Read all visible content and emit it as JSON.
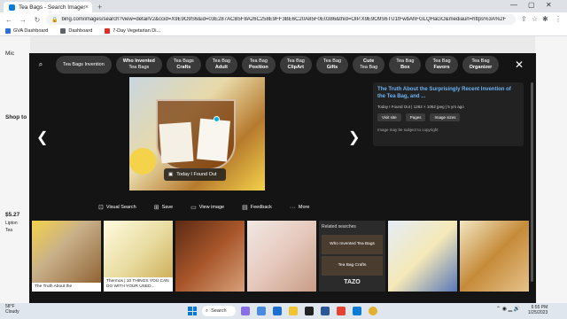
{
  "browser": {
    "tab_title": "Tea Bags - Search Images",
    "tab_close": "×",
    "new_tab": "+",
    "url": "bing.com/images/search?view=detailV2&ccid=X9E9O9S6&id=03E287ACB5F8A26C258E9FF3BE6C20A85F0E0386&thid=OIP.X9E9O9S6TU1tFwbAhFGLQHaGO&mediaurl=https%3A%2F",
    "bookmarks": [
      {
        "label": "GVA Dashboard",
        "color": "#2f6fd6"
      },
      {
        "label": "Dashboard",
        "color": "#5f6368"
      },
      {
        "label": "7-Day Vegetarian Di...",
        "color": "#d93025"
      }
    ]
  },
  "background_page": {
    "side_labels": [
      "Mic",
      "Shop to",
      "$5.27",
      "Lipton",
      "Tea"
    ]
  },
  "overlay": {
    "chips": [
      {
        "line1": "Tea Bags Invention",
        "line2": ""
      },
      {
        "line1": "Who Invented",
        "line2": "Tea Bags"
      },
      {
        "line1": "Tea Bags",
        "line2": "Crafts"
      },
      {
        "line1": "Tea Bag",
        "line2": "Adult"
      },
      {
        "line1": "Tea Bag",
        "line2": "Position"
      },
      {
        "line1": "Tea Bag",
        "line2": "ClipArt"
      },
      {
        "line1": "Tea Bag",
        "line2": "Gifts"
      },
      {
        "line1": "Cute",
        "line2": "Tea Bag"
      },
      {
        "line1": "Tea Bag",
        "line2": "Box"
      },
      {
        "line1": "Tea Bag",
        "line2": "Favors"
      },
      {
        "line1": "Tea Bag",
        "line2": "Organizer"
      }
    ],
    "source_badge": "Today I Found Out",
    "info": {
      "title": "The Truth About the Surprisingly Recent Invention of the Tea Bag, and ...",
      "meta": "Today I Found Out  |  1262 × 1062 jpeg  |  5 yrs ago",
      "buttons": [
        "Visit site",
        "Pages",
        "Image sizes"
      ],
      "note": "Image may be subject to copyright"
    },
    "actions": [
      "Visual Search",
      "Save",
      "View image",
      "Feedback",
      "More"
    ],
    "thumbs": [
      {
        "caption": "The Truth About the"
      },
      {
        "caption": "Thermos | 10 THINGS YOU CAN DO WITH YOUR USED..."
      },
      {
        "caption": ""
      },
      {
        "caption": ""
      }
    ],
    "related": {
      "heading": "Related searches",
      "items": [
        "Who Invented Tea Bags",
        "Tea Bag Crafts"
      ]
    },
    "bottom_text": "TAZO"
  },
  "taskbar": {
    "weather_temp": "58°F",
    "weather_desc": "Cloudy",
    "search_label": "Search",
    "time": "6:55 PM",
    "date": "1/25/2023"
  }
}
